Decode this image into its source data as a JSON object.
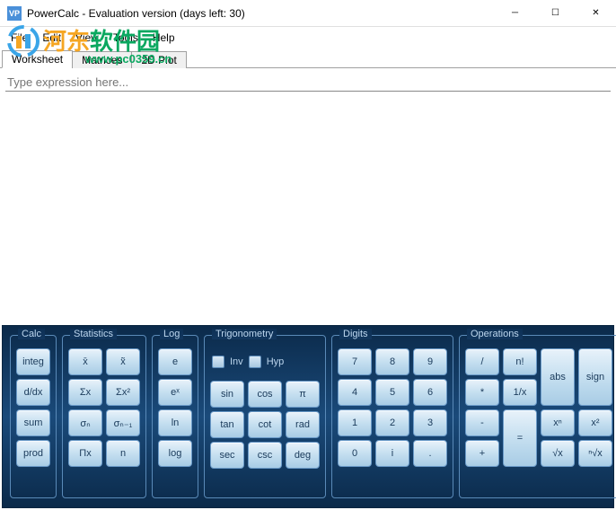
{
  "window": {
    "title": "PowerCalc - Evaluation version (days left: 30)",
    "icon_text": "VP"
  },
  "menu": [
    "File",
    "Edit",
    "View",
    "Tools",
    "Help"
  ],
  "tabs": [
    "Worksheet",
    "Matrices",
    "2D Plot"
  ],
  "active_tab": 0,
  "input": {
    "placeholder": "Type expression here..."
  },
  "watermark": {
    "part1": "河东",
    "part2": "软件园",
    "url": "www.pc0359.cn"
  },
  "groups": {
    "calc": {
      "title": "Calc",
      "buttons": [
        "integ",
        "d/dx",
        "sum",
        "prod"
      ]
    },
    "stats": {
      "title": "Statistics",
      "buttons": [
        "x̄",
        "x̃",
        "Σx",
        "Σx²",
        "σₙ",
        "σₙ₋₁",
        "Πx",
        "n"
      ]
    },
    "log": {
      "title": "Log",
      "buttons": [
        "e",
        "eˣ",
        "ln",
        "log"
      ]
    },
    "trig": {
      "title": "Trigonometry",
      "inv": "Inv",
      "hyp": "Hyp",
      "buttons": [
        "sin",
        "cos",
        "π",
        "tan",
        "cot",
        "rad",
        "sec",
        "csc",
        "deg"
      ]
    },
    "digits": {
      "title": "Digits",
      "buttons": [
        "7",
        "8",
        "9",
        "4",
        "5",
        "6",
        "1",
        "2",
        "3",
        "0",
        "i",
        "."
      ]
    },
    "ops": {
      "title": "Operations",
      "buttons": [
        "/",
        "n!",
        "",
        "",
        "*",
        "1/x",
        "abs",
        "sign",
        "-",
        "=",
        "xⁿ",
        "x²",
        "+",
        "",
        "√x",
        "ⁿ√x"
      ]
    }
  }
}
